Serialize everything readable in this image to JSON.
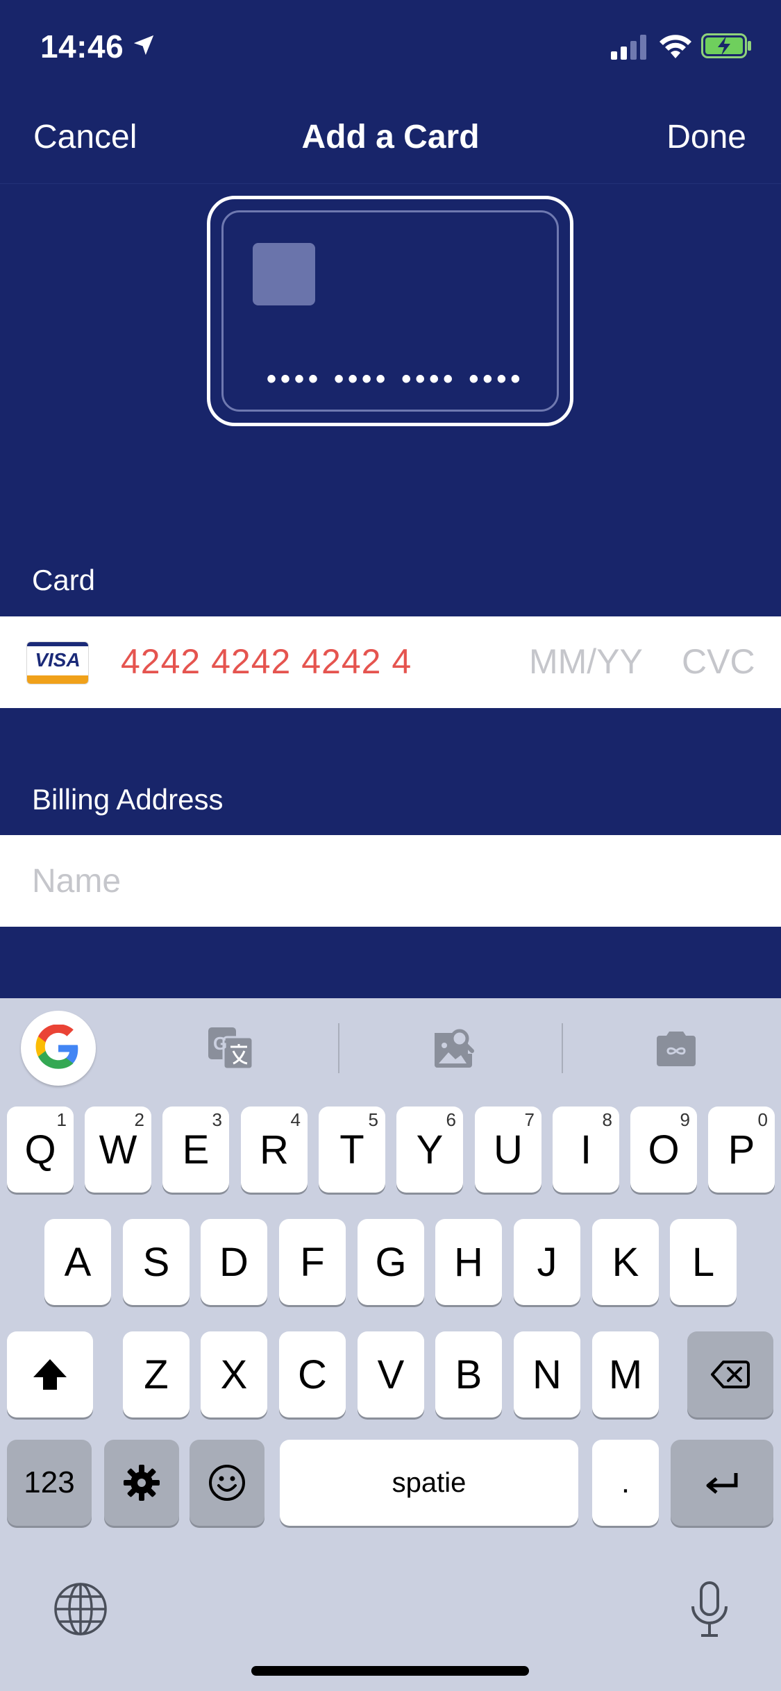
{
  "status_bar": {
    "time": "14:46",
    "icons": [
      "location-arrow-icon",
      "signal-icon",
      "wifi-icon",
      "battery-charging-icon"
    ]
  },
  "nav": {
    "cancel_label": "Cancel",
    "title": "Add a Card",
    "done_label": "Done"
  },
  "card_preview": {
    "masked_number": "•••• •••• •••• ••••"
  },
  "card_section": {
    "label": "Card",
    "brand": "VISA",
    "number_value": "4242 4242 4242 4",
    "expiry_placeholder": "MM/YY",
    "cvc_placeholder": "CVC"
  },
  "billing_section": {
    "label": "Billing Address",
    "name_placeholder": "Name"
  },
  "keyboard": {
    "row1": [
      {
        "label": "Q",
        "num": "1"
      },
      {
        "label": "W",
        "num": "2"
      },
      {
        "label": "E",
        "num": "3"
      },
      {
        "label": "R",
        "num": "4"
      },
      {
        "label": "T",
        "num": "5"
      },
      {
        "label": "Y",
        "num": "6"
      },
      {
        "label": "U",
        "num": "7"
      },
      {
        "label": "I",
        "num": "8"
      },
      {
        "label": "O",
        "num": "9"
      },
      {
        "label": "P",
        "num": "0"
      }
    ],
    "row2": [
      "A",
      "S",
      "D",
      "F",
      "G",
      "H",
      "J",
      "K",
      "L"
    ],
    "row3": [
      "Z",
      "X",
      "C",
      "V",
      "B",
      "N",
      "M"
    ],
    "numbers_label": "123",
    "space_label": "spatie",
    "period_label": ".",
    "colors": {
      "background": "#cbd0e0",
      "key": "#ffffff",
      "dark_key": "#a8adb8"
    }
  },
  "colors": {
    "navy": "#18256a",
    "card_number": "#e5544f",
    "placeholder": "#c5c6cb"
  }
}
